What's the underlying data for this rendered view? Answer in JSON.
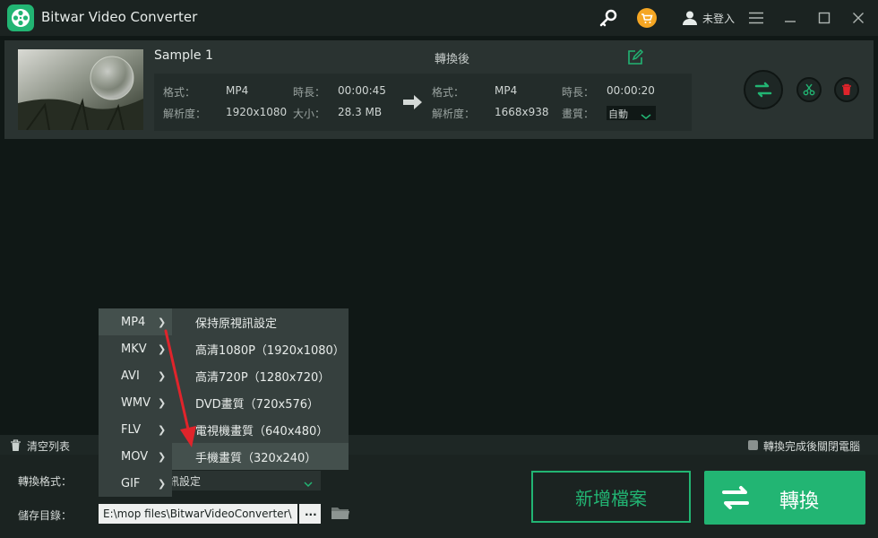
{
  "app": {
    "title": "Bitwar Video Converter",
    "login": "未登入"
  },
  "file": {
    "name": "Sample 1",
    "after_label": "轉換後",
    "source": {
      "format_label": "格式：",
      "format": "MP4",
      "resolution_label": "解析度：",
      "resolution": "1920x1080",
      "duration_label": "時長：",
      "duration": "00:00:45",
      "size_label": "大小：",
      "size": "28.3 MB"
    },
    "target": {
      "format_label": "格式：",
      "format": "MP4",
      "resolution_label": "解析度：",
      "resolution": "1668x938",
      "duration_label": "時長：",
      "duration": "00:00:20",
      "quality_label": "畫質：",
      "quality": "自動"
    }
  },
  "bottom": {
    "clear_list": "清空列表",
    "shutdown_label": "轉換完成後關閉電腦",
    "convert_format_label": "轉換格式：",
    "format_value": "訊設定",
    "save_dir_label": "儲存目錄：",
    "save_path": "E:\\mop files\\BitwarVideoConverter\\",
    "browse_label": "...",
    "add_files": "新增檔案",
    "convert": "轉換"
  },
  "menu": {
    "formats": [
      "MP4",
      "MKV",
      "AVI",
      "WMV",
      "FLV",
      "MOV",
      "GIF"
    ],
    "presets": [
      "保持原視訊設定",
      "高清1080P（1920x1080）",
      "高清720P（1280x720）",
      "DVD畫質（720x576）",
      "電視機畫質（640x480）",
      "手機畫質（320x240）"
    ]
  },
  "colors": {
    "accent": "#22b573",
    "annotation_arrow": "#e0242b"
  }
}
